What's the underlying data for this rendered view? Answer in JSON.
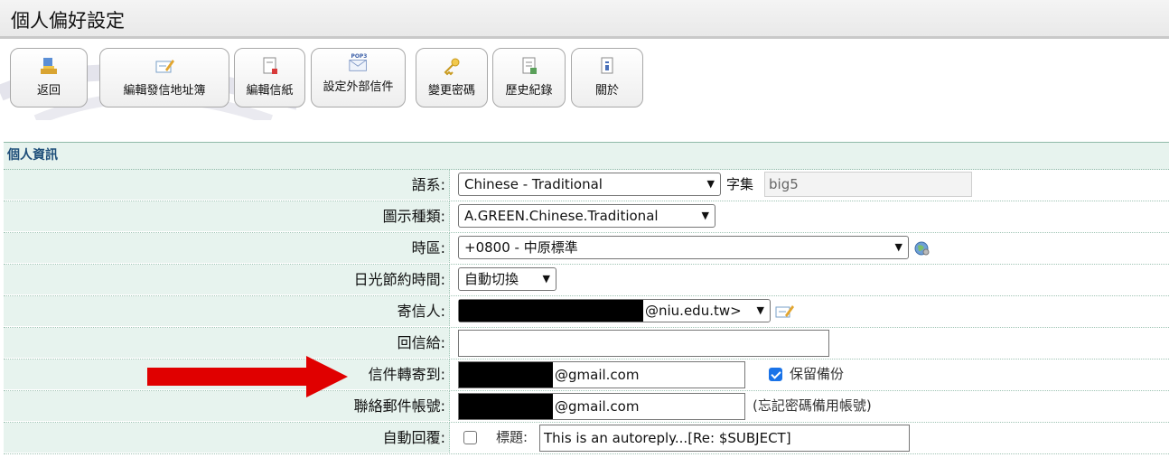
{
  "title": "個人偏好設定",
  "toolbar": {
    "buttons": [
      {
        "label": "返回",
        "icon": "back-icon"
      },
      {
        "label": "編輯發信地址簿",
        "icon": "address-book-icon"
      },
      {
        "label": "編輯信紙",
        "icon": "stationery-icon"
      },
      {
        "label": "設定外部信件",
        "icon": "pop3-mail-icon"
      },
      {
        "label": "變更密碼",
        "icon": "key-icon"
      },
      {
        "label": "歷史紀錄",
        "icon": "history-icon"
      },
      {
        "label": "關於",
        "icon": "about-icon"
      }
    ],
    "pop3_text": "POP3"
  },
  "section": {
    "title": "個人資訊",
    "language": {
      "label": "語系:",
      "value": "Chinese - Traditional",
      "charset_label": "字集",
      "charset_value": "big5"
    },
    "icon_type": {
      "label": "圖示種類:",
      "value": "A.GREEN.Chinese.Traditional"
    },
    "timezone": {
      "label": "時區:",
      "value": "+0800 - 中原標準"
    },
    "dst": {
      "label": "日光節約時間:",
      "value": "自動切換"
    },
    "sender": {
      "label": "寄信人:",
      "value": "@niu.edu.tw>"
    },
    "reply_to": {
      "label": "回信給:",
      "value": ""
    },
    "forward": {
      "label": "信件轉寄到:",
      "value": "@gmail.com",
      "keep_copy_label": "保留備份",
      "keep_copy": true
    },
    "contact": {
      "label": "聯絡郵件帳號:",
      "value": "@gmail.com",
      "note": "(忘記密碼備用帳號)"
    },
    "autoreply": {
      "label": "自動回覆:",
      "enabled": false,
      "subject_label": "標題:",
      "subject_value": "This is an autoreply...[Re: $SUBJECT]"
    }
  },
  "colors": {
    "row_bg": "#e7f3ee",
    "annotation_arrow": "#e00000",
    "checkbox_accent": "#1a73e8"
  }
}
